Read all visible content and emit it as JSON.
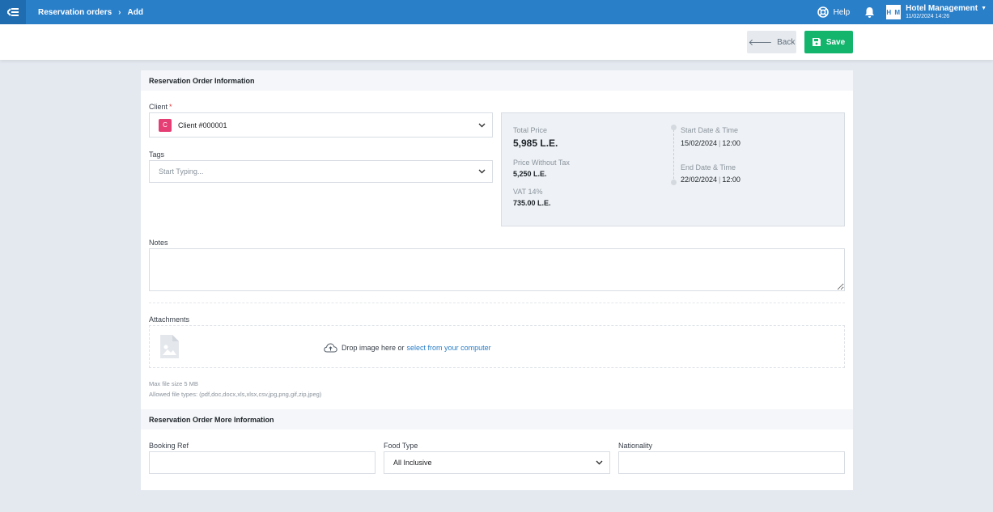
{
  "topbar": {
    "breadcrumb": [
      "Reservation orders",
      "Add"
    ],
    "help_label": "Help",
    "user_initials": "H M",
    "user_name": "Hotel Management",
    "user_datetime": "11/02/2024 14:26",
    "color": "#2a7fc9"
  },
  "actions": {
    "back_label": "Back",
    "save_label": "Save",
    "save_color": "#13b56d"
  },
  "form": {
    "section_title": "Reservation Order Information",
    "client_label": "Client",
    "client_required": "*",
    "client_badge": "C",
    "client_value": "Client #000001",
    "tags_label": "Tags",
    "tags_placeholder": "Start Typing...",
    "notes_label": "Notes",
    "attachments_label": "Attachments",
    "drop_text": "Drop image here or",
    "drop_link": "select from your computer",
    "max_size": "Max file size 5 MB",
    "allowed_types": "Allowed file types: (pdf,doc,docx,xls,xlsx,csv,jpg,png,gif,zip,jpeg)"
  },
  "summary": {
    "total_price_label": "Total Price",
    "total_price": "5,985 L.E.",
    "price_without_tax_label": "Price Without Tax",
    "price_without_tax": "5,250 L.E.",
    "vat_label": "VAT 14%",
    "vat": "735.00 L.E.",
    "start_label": "Start Date & Time",
    "start_date": "15/02/2024",
    "start_time": "12:00",
    "end_label": "End Date & Time",
    "end_date": "22/02/2024",
    "end_time": "12:00"
  },
  "more": {
    "section_title": "Reservation Order More Information",
    "booking_ref_label": "Booking Ref",
    "food_type_label": "Food Type",
    "food_type_value": "All Inclusive",
    "nationality_label": "Nationality"
  }
}
